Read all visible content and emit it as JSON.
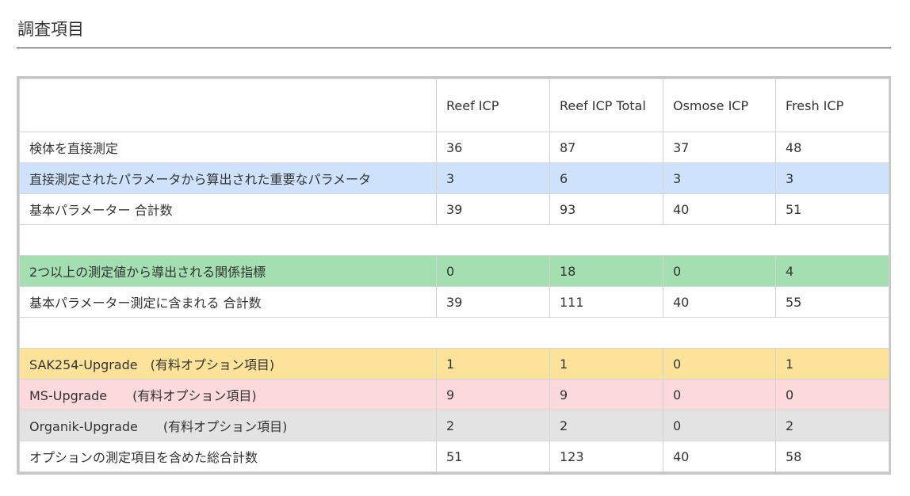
{
  "section": {
    "title": "調査項目"
  },
  "table": {
    "headers": [
      "",
      "Reef ICP",
      "Reef ICP Total",
      "Osmose ICP",
      "Fresh ICP"
    ],
    "rows": [
      {
        "label": "検体を直接測定",
        "values": [
          "36",
          "87",
          "37",
          "48"
        ],
        "highlight": "none"
      },
      {
        "label": "直接測定されたパラメータから算出された重要なパラメータ",
        "values": [
          "3",
          "6",
          "3",
          "3"
        ],
        "highlight": "#cfe2fb"
      },
      {
        "label": "基本パラメーター 合計数",
        "values": [
          "39",
          "93",
          "40",
          "51"
        ],
        "highlight": "none"
      },
      {
        "label": "",
        "values": [
          "",
          "",
          "",
          ""
        ],
        "highlight": "none"
      },
      {
        "label": "2つ以上の測定値から導出される関係指標",
        "values": [
          "0",
          "18",
          "0",
          "4"
        ],
        "highlight": "#a3dfb1"
      },
      {
        "label": "基本パラメーター測定に含まれる 合計数",
        "values": [
          "39",
          "111",
          "40",
          "55"
        ],
        "highlight": "none"
      },
      {
        "label": "",
        "values": [
          "",
          "",
          "",
          ""
        ],
        "highlight": "none"
      },
      {
        "label": "SAK254-Upgrade　(有料オプション項目)",
        "values": [
          "1",
          "1",
          "0",
          "1"
        ],
        "highlight": "#fde29a"
      },
      {
        "label": "MS-Upgrade　　(有料オプション項目)",
        "values": [
          "9",
          "9",
          "0",
          "0"
        ],
        "highlight": "#fcd9db"
      },
      {
        "label": "Organik-Upgrade　　(有料オプション項目)",
        "values": [
          "2",
          "2",
          "0",
          "2"
        ],
        "highlight": "#e3e3e3"
      },
      {
        "label": "オプションの測定項目を含めた総合計数",
        "values": [
          "51",
          "123",
          "40",
          "58"
        ],
        "highlight": "none"
      }
    ]
  },
  "colors": {
    "frame": "#c6c6c6",
    "grid": "#d4d4d4",
    "text": "#333333"
  }
}
